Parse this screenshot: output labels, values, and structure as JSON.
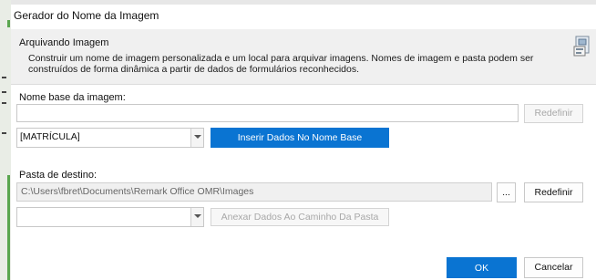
{
  "window": {
    "title": "Gerador do Nome da Imagem"
  },
  "header": {
    "section_title": "Arquivando Imagem",
    "description": "Construir um nome de imagem personalizada e um local para arquivar imagens. Nomes de imagem e pasta podem ser construídos de forma dinâmica a partir de dados de formulários reconhecidos.",
    "icon": "image-archive-icon"
  },
  "base_name": {
    "label": "Nome base da imagem:",
    "value": "",
    "reset_label": "Redefinir",
    "field_select_value": "[MATRÍCULA]",
    "insert_label": "Inserir Dados No Nome Base"
  },
  "destination": {
    "label": "Pasta de destino:",
    "value": "C:\\Users\\fbret\\Documents\\Remark Office OMR\\Images",
    "browse_label": "...",
    "reset_label": "Redefinir",
    "field_select_value": "",
    "append_label": "Anexar Dados Ao Caminho Da Pasta"
  },
  "footer": {
    "ok_label": "OK",
    "cancel_label": "Cancelar"
  },
  "colors": {
    "primary": "#0a74d2",
    "header_band": "#f0f0f0"
  }
}
